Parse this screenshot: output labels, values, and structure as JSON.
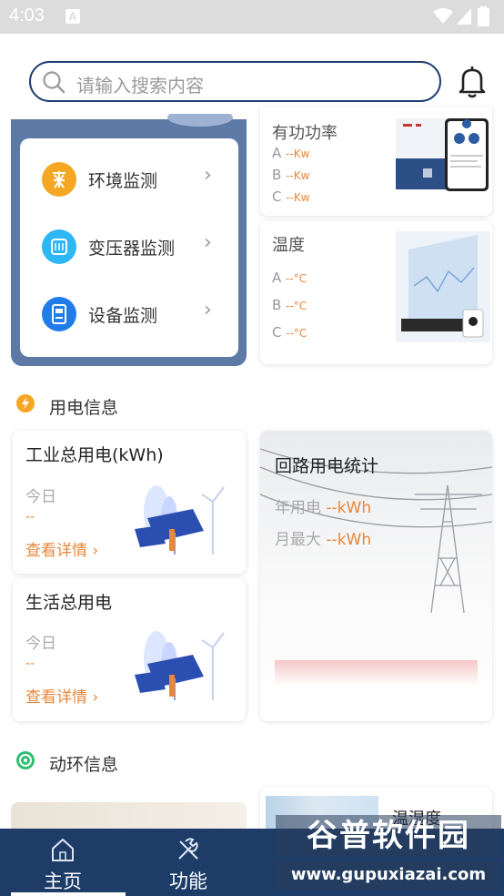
{
  "status_bar": {
    "time": "4:03",
    "notif_letter": "A"
  },
  "search": {
    "placeholder": "请输入搜索内容"
  },
  "monitor_menu": {
    "items": [
      {
        "label": "环境监测",
        "icon": "environment-icon",
        "color": "#f5a623"
      },
      {
        "label": "变压器监测",
        "icon": "transformer-icon",
        "color": "#2db7f5"
      },
      {
        "label": "设备监测",
        "icon": "device-icon",
        "color": "#1f7ce8"
      }
    ],
    "arrow": "›"
  },
  "active_power": {
    "title": "有功功率",
    "rows": [
      {
        "phase": "A",
        "value": "--Kw"
      },
      {
        "phase": "B",
        "value": "--Kw"
      },
      {
        "phase": "C",
        "value": "--Kw"
      }
    ]
  },
  "temperature": {
    "title": "温度",
    "rows": [
      {
        "phase": "A",
        "value": "--°C"
      },
      {
        "phase": "B",
        "value": "--°C"
      },
      {
        "phase": "C",
        "value": "--°C"
      }
    ]
  },
  "electricity_section": {
    "title": "用电信息",
    "icon": "lightning-icon",
    "color": "#f5a623"
  },
  "industrial": {
    "title": "工业总用电(kWh)",
    "today_label": "今日",
    "today_value": "--",
    "detail": "查看详情"
  },
  "domestic": {
    "title": "生活总用电",
    "today_label": "今日",
    "today_value": "--",
    "detail": "查看详情"
  },
  "loop_stats": {
    "title": "回路用电统计",
    "year_label": "年用电",
    "year_value": "--kWh",
    "month_label": "月最大",
    "month_value": "--kWh"
  },
  "env_section": {
    "title": "动环信息",
    "icon": "target-icon",
    "color": "#2fbf71"
  },
  "humidity": {
    "title": "温湿度"
  },
  "bottom_nav": {
    "items": [
      {
        "label": "主页",
        "icon": "home-icon"
      },
      {
        "label": "功能",
        "icon": "tools-icon"
      }
    ]
  },
  "watermark": {
    "text": "谷普软件园",
    "url": "www.gupuxiazai.com"
  }
}
